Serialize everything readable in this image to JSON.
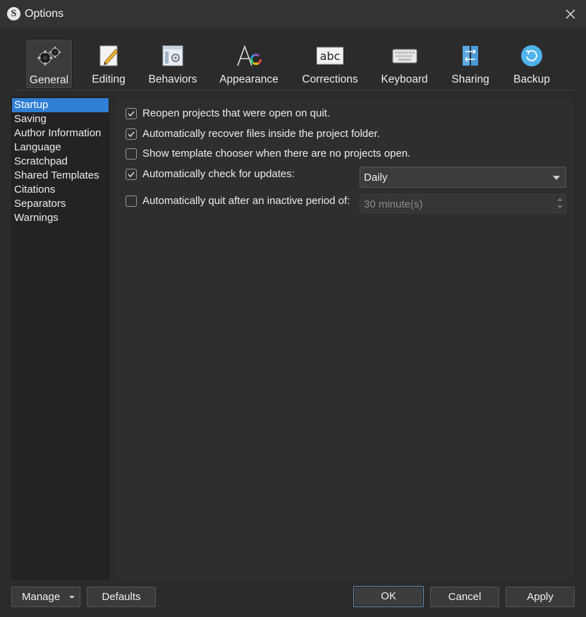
{
  "window": {
    "title": "Options",
    "app_icon_letter": "S"
  },
  "toolbar": {
    "items": [
      {
        "label": "General",
        "icon": "gears-icon"
      },
      {
        "label": "Editing",
        "icon": "pencil-page-icon"
      },
      {
        "label": "Behaviors",
        "icon": "window-gear-icon"
      },
      {
        "label": "Appearance",
        "icon": "font-color-wheel-icon"
      },
      {
        "label": "Corrections",
        "icon": "abc-icon"
      },
      {
        "label": "Keyboard",
        "icon": "keyboard-icon"
      },
      {
        "label": "Sharing",
        "icon": "sync-arrows-icon"
      },
      {
        "label": "Backup",
        "icon": "backup-icon"
      }
    ],
    "selected": "General"
  },
  "sidebar": {
    "items": [
      {
        "label": "Startup"
      },
      {
        "label": "Saving"
      },
      {
        "label": "Author Information"
      },
      {
        "label": "Language"
      },
      {
        "label": "Scratchpad"
      },
      {
        "label": "Shared Templates"
      },
      {
        "label": "Citations"
      },
      {
        "label": "Separators"
      },
      {
        "label": "Warnings"
      }
    ],
    "selected": "Startup"
  },
  "options": {
    "reopen": {
      "label": "Reopen projects that were open on quit.",
      "checked": true
    },
    "recover": {
      "label": "Automatically recover files inside the project folder.",
      "checked": true
    },
    "template_chooser": {
      "label": "Show template chooser when there are no projects open.",
      "checked": false
    },
    "check_updates": {
      "label": "Automatically check for updates:",
      "checked": true,
      "frequency": "Daily"
    },
    "auto_quit": {
      "label": "Automatically quit after an inactive period of:",
      "checked": false,
      "period": "30 minute(s)"
    }
  },
  "footer": {
    "manage_label": "Manage",
    "defaults_label": "Defaults",
    "ok_label": "OK",
    "cancel_label": "Cancel",
    "apply_label": "Apply"
  },
  "colors": {
    "selection": "#2f7fd4",
    "background": "#2b2b2b",
    "accent_blue": "#4fb3ea"
  }
}
